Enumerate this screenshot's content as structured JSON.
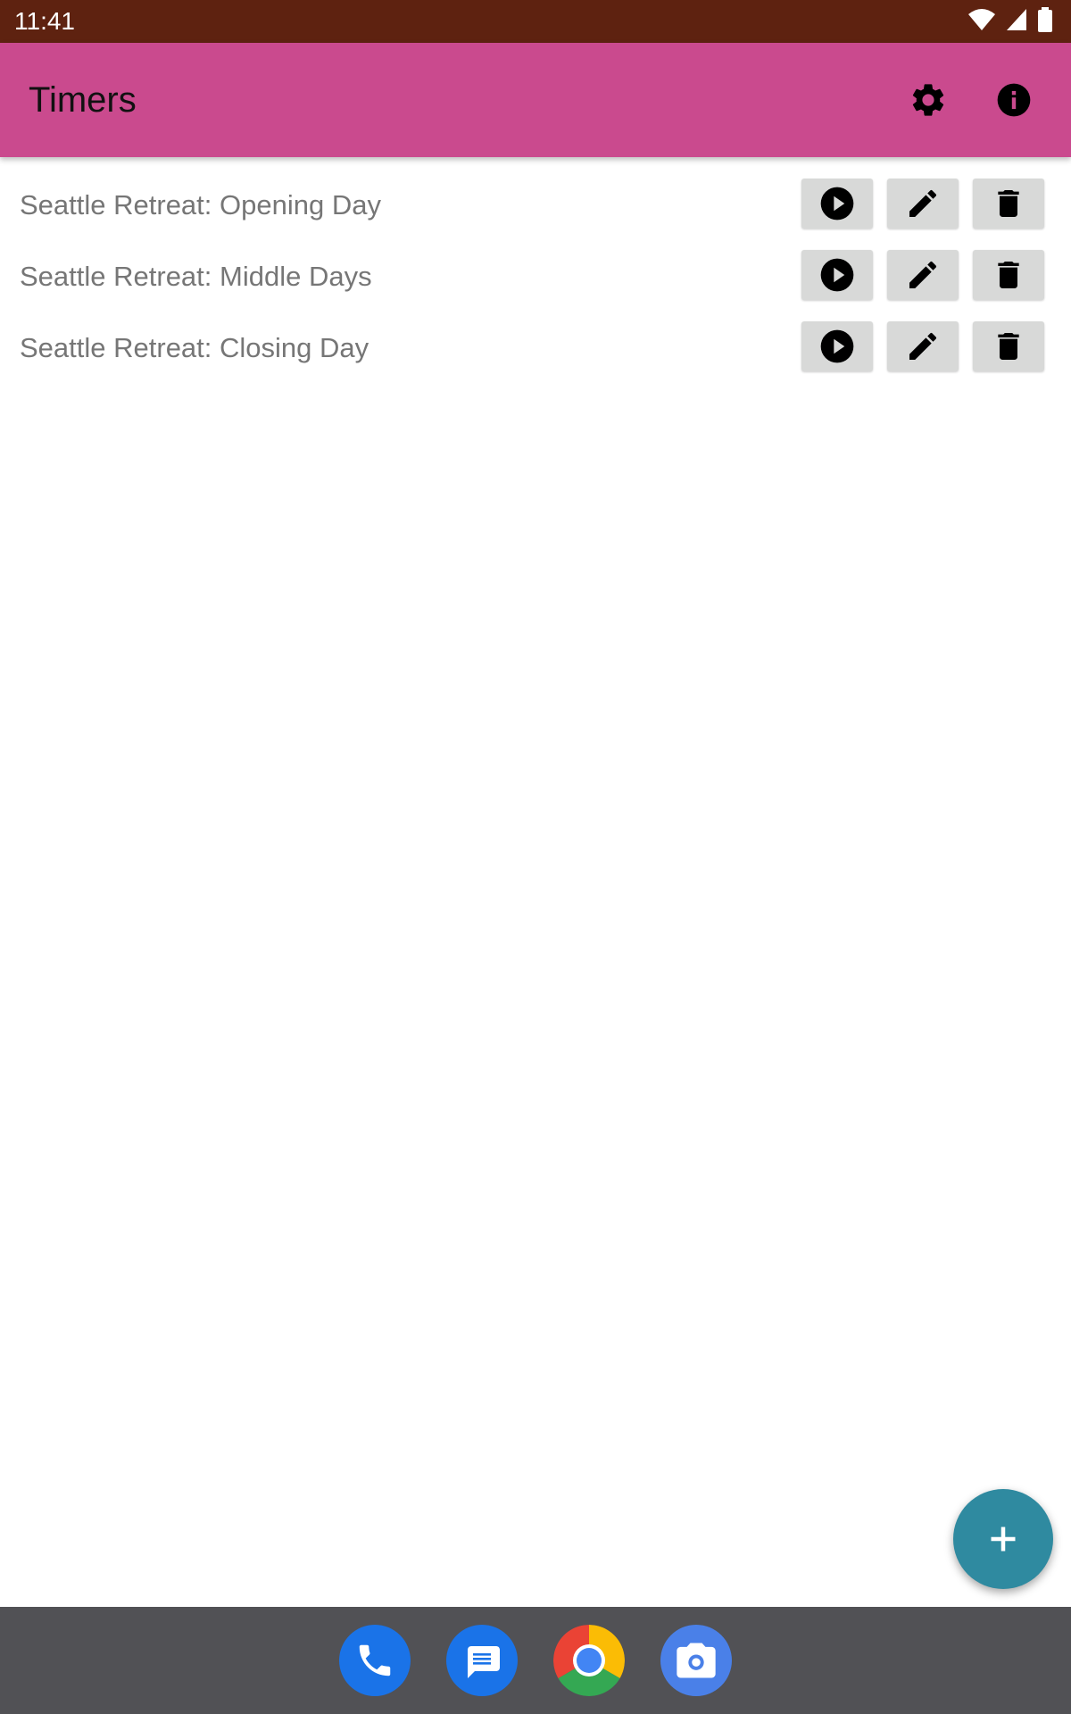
{
  "status_bar": {
    "time": "11:41"
  },
  "app_bar": {
    "title": "Timers"
  },
  "timers": [
    {
      "name": "Seattle Retreat: Opening Day"
    },
    {
      "name": "Seattle Retreat: Middle Days"
    },
    {
      "name": "Seattle Retreat: Closing Day"
    }
  ],
  "icons": {
    "settings": "gear-icon",
    "info": "info-icon",
    "play": "play-icon",
    "edit": "pencil-icon",
    "delete": "trash-icon",
    "add": "plus-icon"
  },
  "dock": [
    "phone",
    "messages",
    "chrome",
    "camera"
  ],
  "colors": {
    "status_bar": "#5e2210",
    "app_bar": "#ca4a8e",
    "fab": "#2f8aa0",
    "nav_bar": "#515155",
    "button": "#d8d9d8"
  }
}
